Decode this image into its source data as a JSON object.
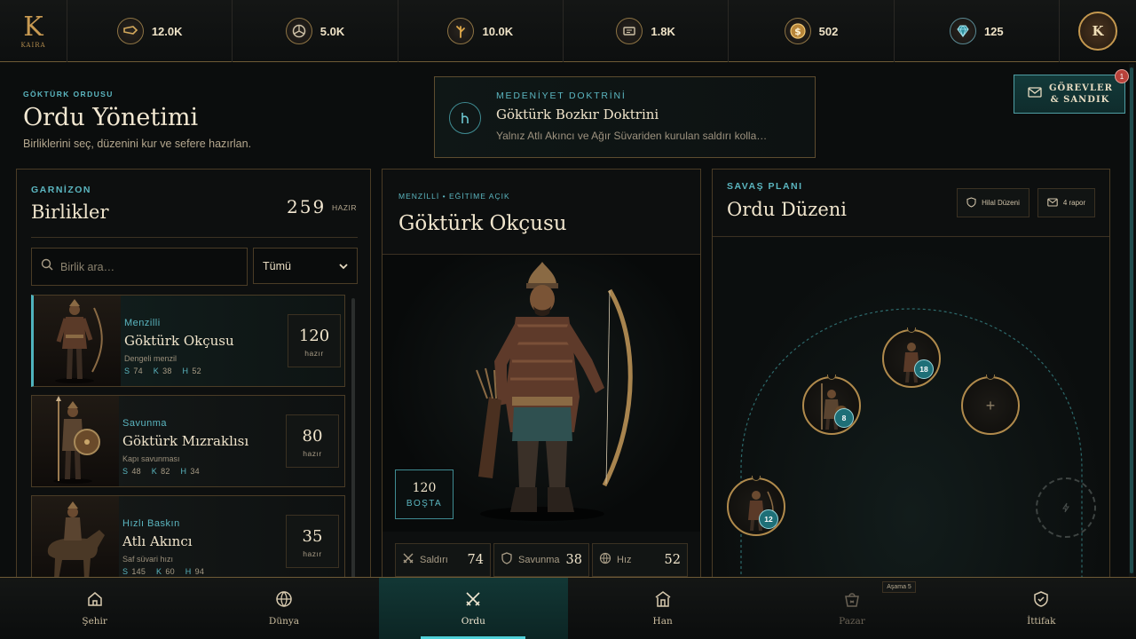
{
  "brand": {
    "letter": "K",
    "wordmark": "KAIRA"
  },
  "resources": [
    {
      "icon": "horn-icon",
      "value": "12.0K"
    },
    {
      "icon": "wheel-icon",
      "value": "5.0K"
    },
    {
      "icon": "herb-icon",
      "value": "10.0K"
    },
    {
      "icon": "scroll-icon",
      "value": "1.8K"
    },
    {
      "icon": "gold-coin-icon",
      "value": "502"
    },
    {
      "icon": "gem-icon",
      "value": "125"
    }
  ],
  "profile": {
    "initial": "K"
  },
  "header": {
    "eyebrow": "GÖKTÜRK ORDUSU",
    "title": "Ordu Yönetimi",
    "subtitle": "Birliklerini seç, düzenini kur ve sefere hazırlan."
  },
  "doctrine": {
    "symbol": "ㄣ",
    "label": "MEDENİYET DOKTRİNİ",
    "name": "Göktürk Bozkır Doktrini",
    "description": "Yalnız Atlı Akıncı ve Ağır Süvariden kurulan saldırı kolla…"
  },
  "quests": {
    "label_line1": "GÖREVLER",
    "label_line2": "& SANDIK",
    "badge": "1"
  },
  "garrison": {
    "eyebrow": "GARNİZON",
    "title": "Birlikler",
    "ready_count": "259",
    "ready_label": "HAZIR",
    "search_placeholder": "Birlik ara…",
    "filter_value": "Tümü",
    "units": [
      {
        "category": "Menzilli",
        "name": "Göktürk Okçusu",
        "description": "Dengeli menzil",
        "s_label": "S",
        "s": "74",
        "k_label": "K",
        "k": "38",
        "h_label": "H",
        "h": "52",
        "count": "120",
        "count_label": "hazır",
        "active": true
      },
      {
        "category": "Savunma",
        "name": "Göktürk Mızraklısı",
        "description": "Kapı savunması",
        "s_label": "S",
        "s": "48",
        "k_label": "K",
        "k": "82",
        "h_label": "H",
        "h": "34",
        "count": "80",
        "count_label": "hazır",
        "active": false
      },
      {
        "category": "Hızlı Baskın",
        "name": "Atlı Akıncı",
        "description": "Saf süvari hızı",
        "s_label": "S",
        "s": "145",
        "k_label": "K",
        "k": "60",
        "h_label": "H",
        "h": "94",
        "count": "35",
        "count_label": "hazır",
        "active": false
      }
    ]
  },
  "unit_detail": {
    "tags": "MENZİLLİ • EĞİTİME AÇIK",
    "name": "Göktürk Okçusu",
    "idle_count": "120",
    "idle_label": "BOŞTA",
    "stats": [
      {
        "icon": "swords-icon",
        "label": "Saldırı",
        "value": "74"
      },
      {
        "icon": "shield-icon",
        "label": "Savunma",
        "value": "38"
      },
      {
        "icon": "globe-icon",
        "label": "Hız",
        "value": "52"
      }
    ]
  },
  "battle_plan": {
    "eyebrow": "SAVAŞ PLANI",
    "title": "Ordu Düzeni",
    "formation_label": "Hilal Düzeni",
    "reports_label": "4 rapor",
    "slots": [
      {
        "count": "12",
        "state": "filled"
      },
      {
        "count": "8",
        "state": "filled"
      },
      {
        "count": "18",
        "state": "filled"
      },
      {
        "count": "",
        "state": "empty"
      },
      {
        "count": "",
        "state": "locked"
      }
    ]
  },
  "stage_tag": "Aşama 5",
  "nav": [
    {
      "icon": "house-icon",
      "label": "Şehir",
      "state": "normal"
    },
    {
      "icon": "globe-icon",
      "label": "Dünya",
      "state": "normal"
    },
    {
      "icon": "crossed-swords-icon",
      "label": "Ordu",
      "state": "active"
    },
    {
      "icon": "inn-icon",
      "label": "Han",
      "state": "normal"
    },
    {
      "icon": "market-icon",
      "label": "Pazar",
      "state": "disabled"
    },
    {
      "icon": "alliance-shield-icon",
      "label": "İttifak",
      "state": "normal"
    }
  ],
  "colors": {
    "accent": "#5bb6c0",
    "gold": "#c4984f",
    "background": "#0b0d0d"
  }
}
